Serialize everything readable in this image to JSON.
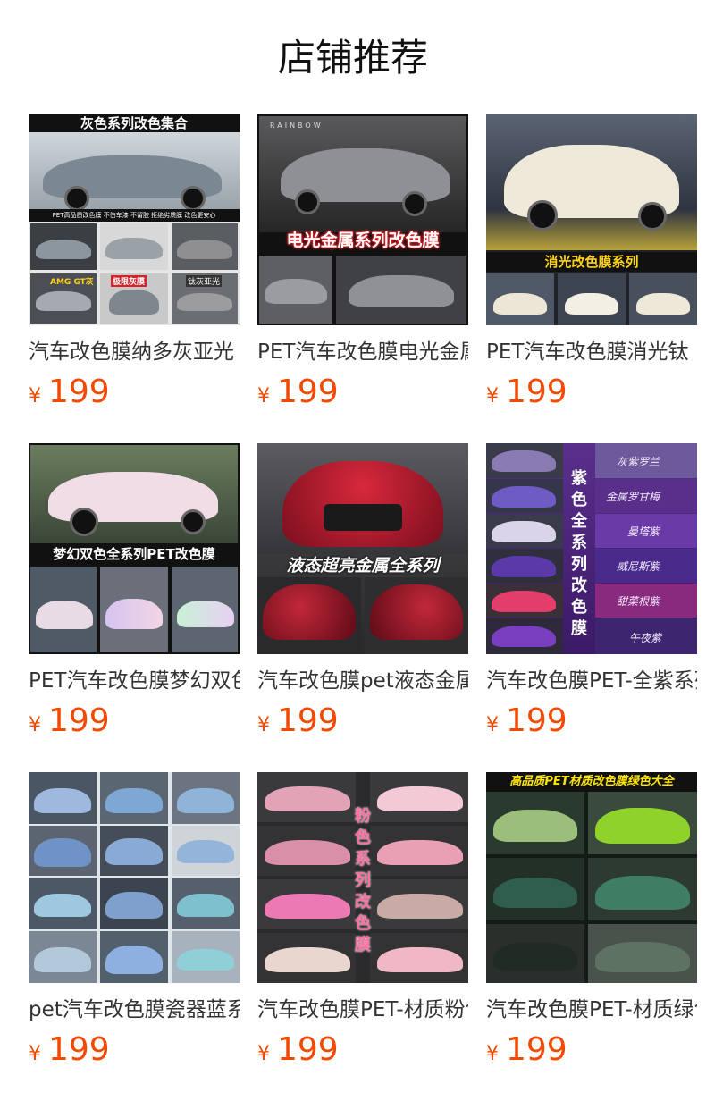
{
  "page": {
    "title": "店铺推荐"
  },
  "products": [
    {
      "name": "汽车改色膜纳多灰亚光",
      "currency": "¥",
      "price": "199",
      "image_banner": "灰色系列改色集合",
      "image_sub": "PET高品质改色膜   不伤车漆   不留胶   拒绝劣质膜   改色更安心",
      "image_tags": [
        "AMG GT灰",
        "极限灰膜",
        "钛灰亚光"
      ],
      "colors": {
        "bg": "#e9e9e9",
        "car": "#7d8a94",
        "banner": "#111111"
      }
    },
    {
      "name": "PET汽车改色膜电光金属",
      "currency": "¥",
      "price": "199",
      "image_banner": "电光金属系列改色膜",
      "image_brand": "RAINBOW",
      "colors": {
        "bg": "#2a2a2a",
        "car": "#8f9196",
        "banner": "#e8232a"
      }
    },
    {
      "name": "PET汽车改色膜消光钛",
      "currency": "¥",
      "price": "199",
      "image_banner": "消光改色膜系列",
      "colors": {
        "bg": "#3a3f4a",
        "car": "#efe9da",
        "banner": "#ffd21a"
      }
    },
    {
      "name": "PET汽车改色膜梦幻双色",
      "currency": "¥",
      "price": "199",
      "image_banner": "梦幻双色全系列PET改色膜",
      "colors": {
        "bg": "#4c5b4a",
        "car": "#f0d9e3",
        "banner": "#111111"
      }
    },
    {
      "name": "汽车改色膜pet液态金属",
      "currency": "¥",
      "price": "199",
      "image_banner": "液态超亮金属全系列",
      "colors": {
        "bg": "#3a3a3c",
        "car": "#9c1526",
        "banner": "#ffffff"
      }
    },
    {
      "name": "汽车改色膜PET-全紫系列",
      "currency": "¥",
      "price": "199",
      "image_vertical": "紫色全系列改色膜",
      "image_swatches": [
        "灰紫罗兰",
        "金属罗甘梅",
        "曼塔紫",
        "威尼斯紫",
        "甜菜根紫",
        "午夜紫"
      ],
      "colors": {
        "bg": "#5a2f8c",
        "car": "#7c4fd0",
        "banner": "#ffffff"
      }
    },
    {
      "name": "pet汽车改色膜瓷器蓝系列",
      "currency": "¥",
      "price": "199",
      "colors": {
        "bg": "#5a6a7a",
        "car": "#7fa3cf",
        "banner": "#ffffff"
      }
    },
    {
      "name": "汽车改色膜PET-材质粉色",
      "currency": "¥",
      "price": "199",
      "image_vertical": "粉色系列改色膜",
      "colors": {
        "bg": "#2e2e30",
        "car": "#e6a4b8",
        "banner": "#ff6fa0"
      }
    },
    {
      "name": "汽车改色膜PET-材质绿色",
      "currency": "¥",
      "price": "199",
      "image_banner": "高品质PET材质改色膜绿色大全",
      "colors": {
        "bg": "#1d2620",
        "car": "#8fcf3a",
        "banner": "#ffe600"
      }
    }
  ]
}
